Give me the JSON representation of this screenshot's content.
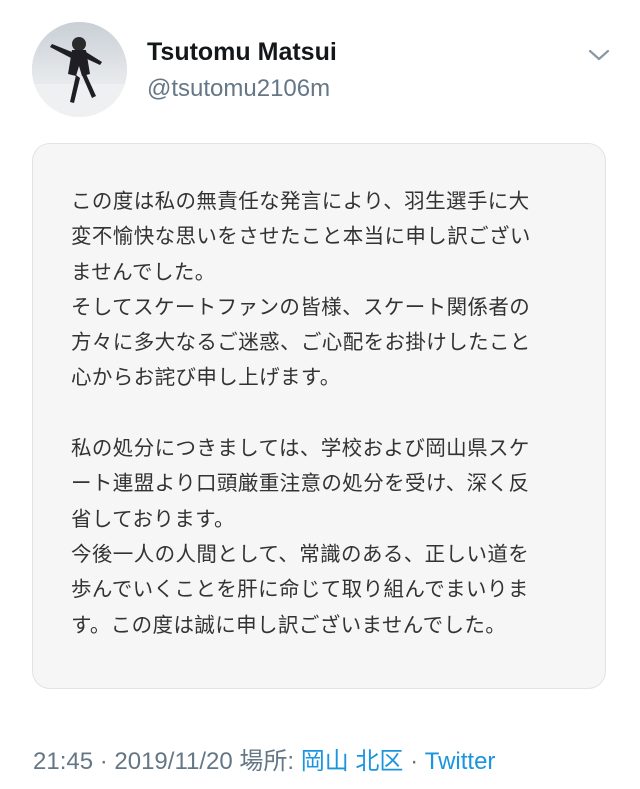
{
  "tweet": {
    "author": {
      "display_name": "Tsutomu Matsui",
      "handle": "@tsutomu2106m",
      "avatar_icon": "profile-photo-figure-skater"
    },
    "menu_icon": "chevron-down-icon",
    "image_text_lines": [
      "この度は私の無責任な発言により、羽生選手に大",
      "変不愉快な思いをさせたこと本当に申し訳ござい",
      "ませんでした。",
      "そしてスケートファンの皆様、スケート関係者の",
      "方々に多大なるご迷惑、ご心配をお掛けしたこと",
      "心からお詫び申し上げます。",
      "",
      "私の処分につきましては、学校および岡山県スケ",
      "ート連盟より口頭厳重注意の処分を受け、深く反",
      "省しております。",
      "今後一人の人間として、常識のある、正しい道を",
      "歩んでいくことを肝に命じて取り組んでまいりま",
      "す。この度は誠に申し訳ございませんでした。"
    ],
    "meta": {
      "time": "21:45",
      "separator": " · ",
      "date": "2019/11/20",
      "location_label": "場所: ",
      "location": "岡山 北区",
      "source": "Twitter"
    }
  },
  "colors": {
    "text_primary": "#14171a",
    "text_secondary": "#657786",
    "link": "#1b95e0",
    "card_background": "#f6f6f6"
  }
}
